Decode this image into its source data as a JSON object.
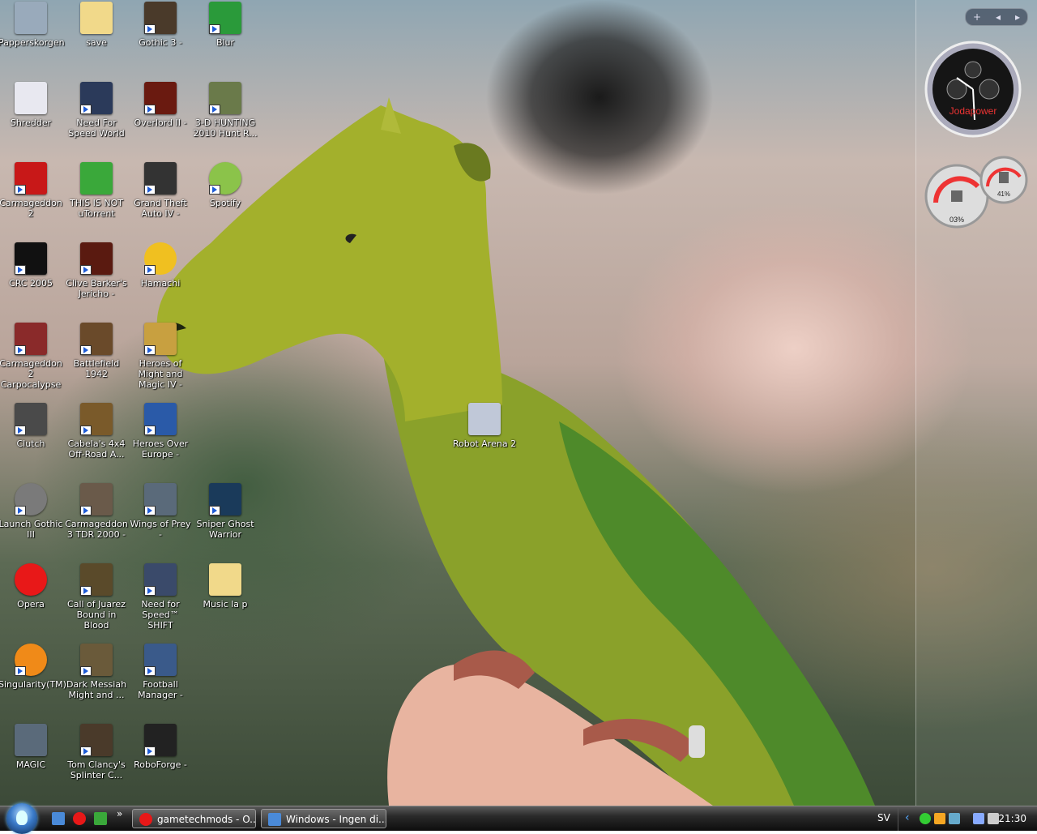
{
  "desktop": {
    "icons": [
      {
        "label": "Papperskorgen",
        "icon": "recycle-bin-icon",
        "color": "#9ab"
      },
      {
        "label": "save",
        "icon": "folder-icon",
        "color": "#f1d98a"
      },
      {
        "label": "Gothic 3 -",
        "icon": "game-icon",
        "color": "#4a3a2a"
      },
      {
        "label": "Blur",
        "icon": "blur-game-icon",
        "color": "#2a9a3a"
      },
      {
        "label": "Shredder",
        "icon": "shredder-icon",
        "color": "#e8e8f0"
      },
      {
        "label": "Need For Speed World",
        "icon": "game-icon",
        "color": "#2b3a5a"
      },
      {
        "label": "Overlord II -",
        "icon": "game-icon",
        "color": "#6a1a10"
      },
      {
        "label": "3-D HUNTING 2010 Hunt R...",
        "icon": "game-icon",
        "color": "#6a7a4a"
      },
      {
        "label": "Carmageddon 2",
        "icon": "game-icon",
        "color": "#c81818"
      },
      {
        "label": "THIS IS NOT uTorrent",
        "icon": "utorrent-icon",
        "color": "#3aa83a"
      },
      {
        "label": "Grand Theft Auto IV -",
        "icon": "game-icon",
        "color": "#333"
      },
      {
        "label": "Spotify",
        "icon": "spotify-icon",
        "color": "#8bc34a"
      },
      {
        "label": "CRC 2005",
        "icon": "game-icon",
        "color": "#111"
      },
      {
        "label": "Clive Barker's Jericho -",
        "icon": "game-icon",
        "color": "#5a1a10"
      },
      {
        "label": "Hamachi",
        "icon": "hamachi-icon",
        "color": "#f0c020"
      },
      {
        "label": "Carmageddon 2 Carpocalypse",
        "icon": "game-icon",
        "color": "#8a2a2a"
      },
      {
        "label": "Battlefield 1942",
        "icon": "game-icon",
        "color": "#6a4a2a"
      },
      {
        "label": "Heroes of Might and Magic IV -",
        "icon": "game-icon",
        "color": "#c8a040"
      },
      {
        "label": "Robot Arena 2",
        "icon": "game-icon",
        "color": "#c0c8d8"
      },
      {
        "label": "Clutch",
        "icon": "game-icon",
        "color": "#4a4a4a"
      },
      {
        "label": "Cabela's 4x4 Off-Road A...",
        "icon": "game-icon",
        "color": "#7a5a2a"
      },
      {
        "label": "Heroes Over Europe -",
        "icon": "game-icon",
        "color": "#2a5aa8"
      },
      {
        "label": "Launch Gothic III",
        "icon": "shield-icon",
        "color": "#7a7a7a"
      },
      {
        "label": "Carmageddon 3 TDR 2000 -",
        "icon": "game-icon",
        "color": "#6a5a4a"
      },
      {
        "label": "Wings of Prey -",
        "icon": "game-icon",
        "color": "#5a6a7a"
      },
      {
        "label": "Sniper Ghost Warrior",
        "icon": "sniper-icon",
        "color": "#1a3a5a"
      },
      {
        "label": "Opera",
        "icon": "opera-icon",
        "color": "#e81818"
      },
      {
        "label": "Call of Juarez Bound in Blood",
        "icon": "game-icon",
        "color": "#5a4a2a"
      },
      {
        "label": "Need for Speed™ SHIFT",
        "icon": "game-icon",
        "color": "#3a4a6a"
      },
      {
        "label": "Music la p",
        "icon": "folder-icon",
        "color": "#f1d98a"
      },
      {
        "label": "Singularity(TM)",
        "icon": "singularity-icon",
        "color": "#f08a18"
      },
      {
        "label": "Dark Messiah Might and ...",
        "icon": "game-icon",
        "color": "#6a5a3a"
      },
      {
        "label": "Football Manager -",
        "icon": "game-icon",
        "color": "#3a5a8a"
      },
      {
        "label": "MAGIC",
        "icon": "magic-icon",
        "color": "#5a6a7a"
      },
      {
        "label": "Tom Clancy's Splinter C...",
        "icon": "game-icon",
        "color": "#4a3a2a"
      },
      {
        "label": "RoboForge -",
        "icon": "roboforge-icon",
        "color": "#222"
      }
    ]
  },
  "sidebar": {
    "add_label": "+",
    "prev_label": "◂",
    "next_label": "▸",
    "clock_brand": "Jodapower",
    "cpu_value": "03%",
    "mem_value": "41%"
  },
  "taskbar": {
    "overflow_label": "»",
    "tasks": [
      {
        "label": "gametechmods - O...",
        "icon": "opera-icon",
        "color": "#e81818"
      },
      {
        "label": "Windows - Ingen di...",
        "icon": "window-icon",
        "color": "#4a8ad8"
      }
    ],
    "language": "SV",
    "clock": "21:30",
    "tray_expand": "‹"
  }
}
